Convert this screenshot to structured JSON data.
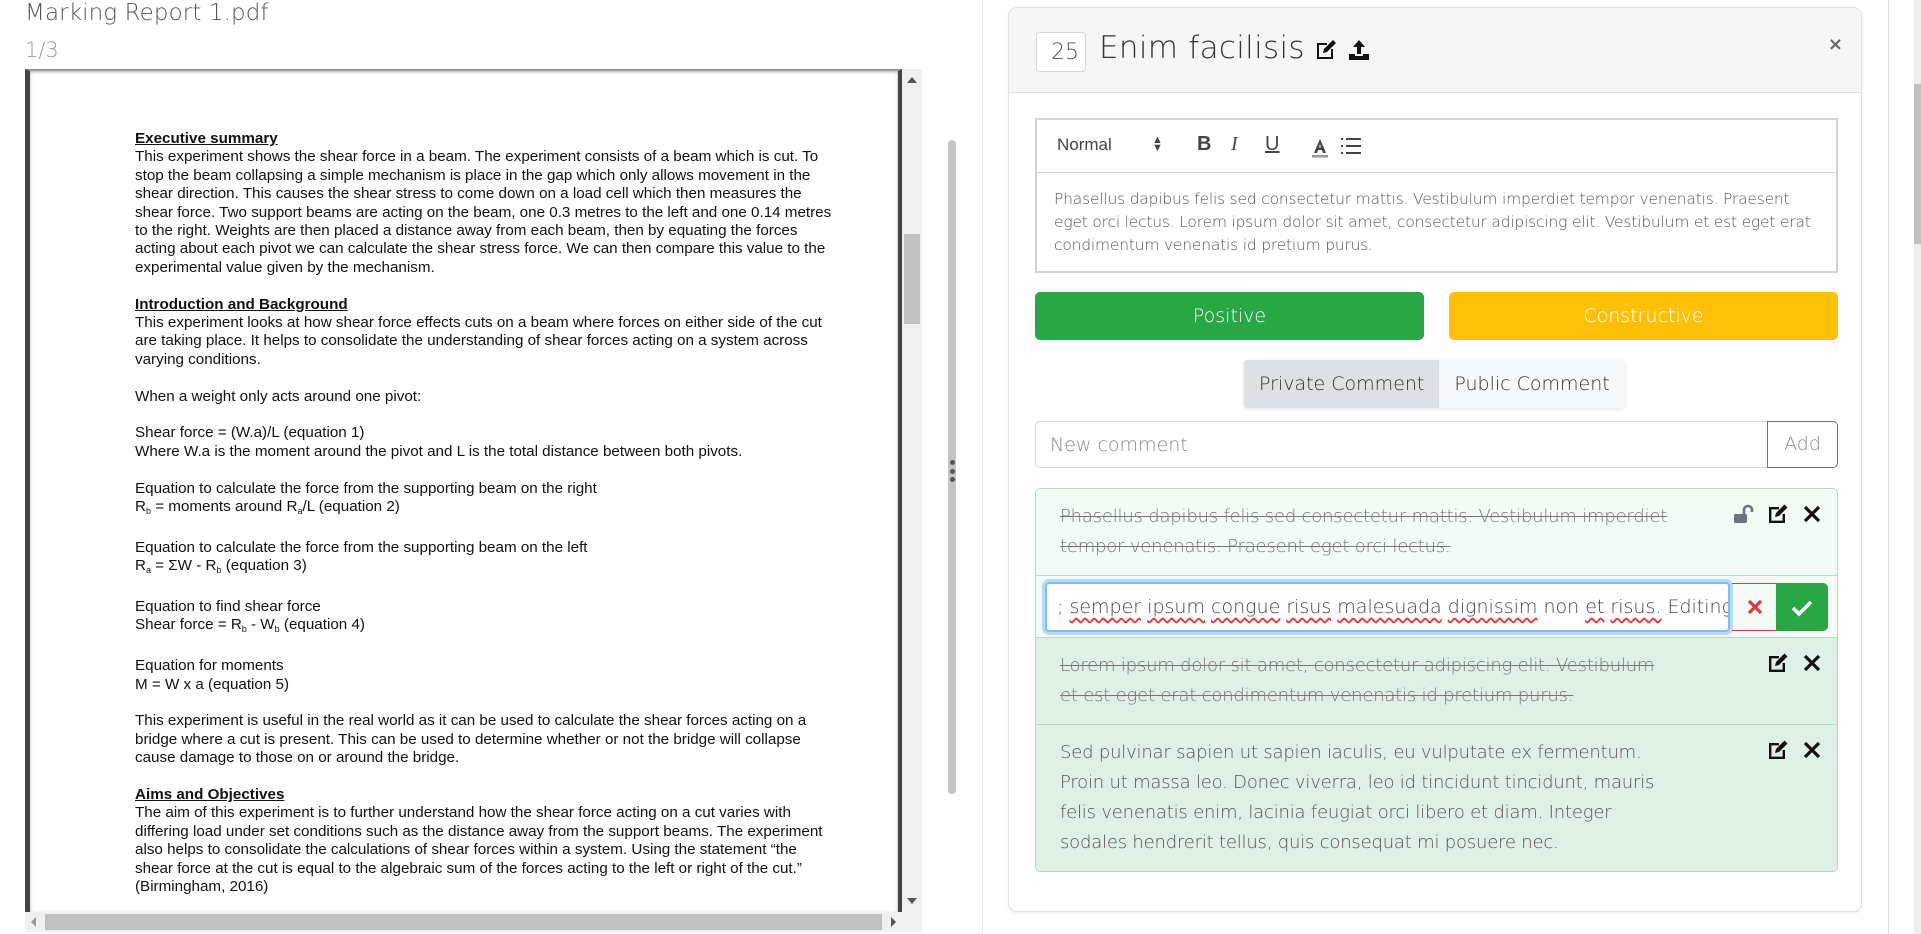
{
  "document": {
    "title": "Marking Report 1.pdf",
    "page_indicator": "1/3",
    "sections": [
      {
        "heading": "Executive summary",
        "paragraphs": [
          "This experiment shows the shear force in a beam. The experiment consists of a beam which is cut. To stop the beam collapsing a simple mechanism is place in the gap which only allows movement in the shear direction. This causes the shear stress to come down on a load cell which then measures the shear force. Two support beams are acting on the beam, one 0.3 metres to the left and one 0.14 metres to the right. Weights are then placed a distance away from each beam, then by equating the forces acting about each pivot we can calculate the shear stress force. We can then compare this value to the experimental value given by the mechanism."
        ]
      },
      {
        "heading": "Introduction and Background",
        "paragraphs": [
          "This experiment looks at how shear force effects cuts on a beam where forces on either side of the cut are taking place. It helps to consolidate the understanding of shear forces acting on a system across varying conditions.",
          "When a weight only acts around one pivot:"
        ],
        "equations": [
          {
            "line1": "Shear force = (W.a)/L  (equation 1)",
            "line2": "Where W.a is the moment around the pivot and L is the total distance between both pivots."
          },
          {
            "line1": "Equation to calculate the force from the supporting beam on the right",
            "line2": "R_b = moments around R_a/L  (equation 2)"
          },
          {
            "line1": "Equation to calculate the force from the supporting beam on the left",
            "line2": "R_a = ΣW - R_b (equation 3)"
          },
          {
            "line1": "Equation to find shear force",
            "line2": "Shear force = R_b - W_b (equation 4)"
          },
          {
            "line1": "Equation for moments",
            "line2": "M = W x a (equation 5)"
          }
        ],
        "closing": "This experiment is useful in the real world as it can be used to calculate the shear forces acting on a bridge where a cut is present. This can be used to determine whether or not the bridge will collapse cause damage to those on or around the bridge."
      },
      {
        "heading": "Aims and Objectives",
        "paragraphs": [
          "The aim of this experiment is to further understand how the shear force acting on a cut varies with differing load under set conditions such as the distance away from the support beams. The experiment also helps to consolidate the calculations of shear forces within a system. Using the statement “the shear force at the cut is equal to the algebraic sum of the forces acting to the left or right of the cut.” (Birmingham, 2016)"
        ]
      }
    ],
    "eq_parts": {
      "eq2_pre": "R",
      "eq2_sub1": "b",
      "eq2_mid": " = moments around R",
      "eq2_sub2": "a",
      "eq2_post": "/L  (equation 2)",
      "eq3_pre": "R",
      "eq3_sub1": "a",
      "eq3_mid": " = ΣW - R",
      "eq3_sub2": "b",
      "eq3_post": " (equation 3)",
      "eq4_pre": "Shear force = R",
      "eq4_sub1": "b",
      "eq4_mid": " - W",
      "eq4_sub2": "b",
      "eq4_post": " (equation 4)"
    }
  },
  "card": {
    "score": "25",
    "title": "Enim facilisis",
    "close_label": "×",
    "editor": {
      "format_select": "Normal",
      "bold": "B",
      "italic": "I",
      "underline": "U",
      "body": "Phasellus dapibus felis sed consectetur mattis. Vestibulum imperdiet tempor venenatis. Praesent eget orci lectus. Lorem ipsum dolor sit amet, consectetur adipiscing elit. Vestibulum et est eget erat condimentum venenatis id pretium purus."
    },
    "buttons": {
      "positive": "Positive",
      "constructive": "Constructive"
    },
    "comment_type": {
      "options": [
        "Private Comment",
        "Public Comment"
      ],
      "selected": "Private Comment"
    },
    "new_comment": {
      "placeholder": "New comment",
      "value": "",
      "add_label": "Add"
    },
    "comments": [
      {
        "text": "Phasellus dapibus felis sed consectetur mattis. Vestibulum imperdiet tempor venenatis. Praesent eget orci lectus.",
        "struck": true,
        "lock_icon": "unlock-icon"
      },
      {
        "editing": true,
        "edit_value_parts": [
          ";",
          "semper",
          "ipsum",
          "congue",
          "risus",
          "malesuada",
          "dignissim",
          "non",
          "et",
          "risus.",
          "Editing"
        ]
      },
      {
        "text": "Lorem ipsum dolor sit amet, consectetur adipiscing elit. Vestibulum et est eget erat condimentum venenatis id pretium purus.",
        "struck": true
      },
      {
        "text": "Sed pulvinar sapien ut sapien iaculis, eu vulputate ex fermentum. Proin ut massa leo. Donec viverra, leo id tincidunt tincidunt, mauris felis venenatis enim, lacinia feugiat orci libero et diam. Integer sodales hendrerit tellus, quis consequat mi posuere nec.",
        "struck": false
      }
    ]
  },
  "colors": {
    "positive": "#28a745",
    "constructive": "#ffc107",
    "danger": "#dc3545",
    "comment_bg": "#dff0e4",
    "focus": "#80bdff"
  }
}
